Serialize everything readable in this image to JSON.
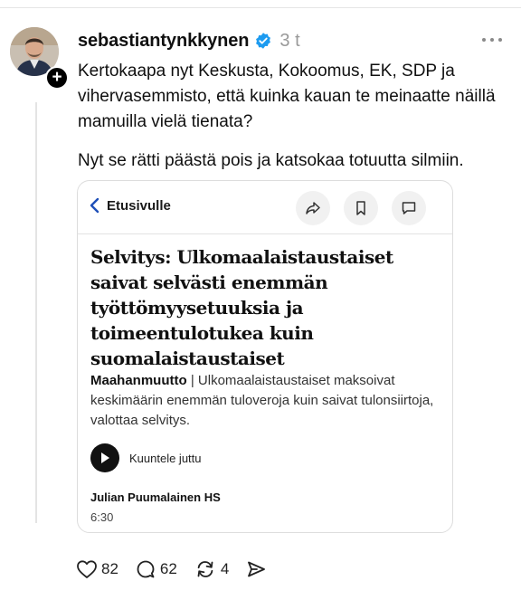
{
  "post": {
    "username": "sebastiantynkkynen",
    "time": "3 t",
    "paragraph1": "Kertokaapa nyt Keskusta, Kokoomus, EK, SDP ja vihervasemmisto, että kuinka kauan te meinaatte näillä mamuilla vielä tienata?",
    "paragraph2": "Nyt se rätti päästä pois ja katsokaa totuutta silmiin."
  },
  "article": {
    "back_label": "Etusivulle",
    "headline": "Selvitys: Ulkomaalaistaustaiset saivat selvästi enemmän työttömyysetuuksia ja toimeentulotukea kuin suomalaistaustaiset",
    "category": "Maahanmuutto",
    "separator": " | ",
    "lead": "Ulkomaalaistaustaiset maksoivat keskimäärin enemmän tuloveroja kuin saivat tulonsiirtoja, valottaa selvitys.",
    "listen_label": "Kuuntele juttu",
    "author": "Julian Puumalainen HS",
    "duration": "6:30"
  },
  "actions": {
    "likes": "82",
    "replies": "62",
    "reposts": "4"
  },
  "icons": [
    "verified-icon",
    "more-icon",
    "plus-icon",
    "back-chevron-icon",
    "share-icon",
    "bookmark-icon",
    "comment-icon",
    "play-icon",
    "heart-icon",
    "reply-icon",
    "repost-icon",
    "send-icon"
  ],
  "colors": {
    "verified": "#1d9bf0",
    "text": "#101010",
    "muted": "#999999"
  }
}
